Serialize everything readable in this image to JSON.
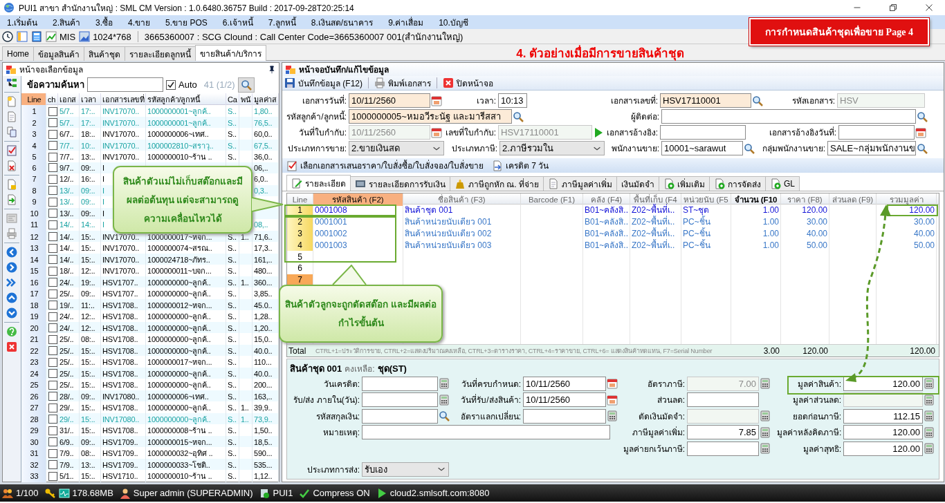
{
  "window": {
    "title": "PUI1 สาขา สำนักงานใหญ่ : SML CM Version : 1.0.6480.36757  Build : 2017-09-28T20:25:14"
  },
  "menu": [
    "1.เริ่มต้น",
    "2.สินค้า",
    "3.ซื้อ",
    "4.ขาย",
    "5.ขาย POS",
    "6.เจ้าหนี้",
    "7.ลูกหนี้",
    "8.เงินสด/ธนาคาร",
    "9.ค่าเสื่อม",
    "10.บัญชี"
  ],
  "toolbar": {
    "buttons": [
      {
        "label": "MIS",
        "kind": "chart"
      },
      {
        "label": "1024*768",
        "kind": "screen"
      }
    ],
    "info": "3665360007 : SCG Clound : Call Center Code=3665360007 001(สำนักงานใหญ่)"
  },
  "banner": "การกำหนดสินค้าชุดเพื่อขาย Page 4",
  "tabs": [
    {
      "label": "Home",
      "selected": false
    },
    {
      "label": "ข้อมูลสินค้า",
      "selected": false
    },
    {
      "label": "สินค้าชุด",
      "selected": false
    },
    {
      "label": "รายละเอียดลูกหนี้",
      "selected": false
    },
    {
      "label": "ขายสินค้า/บริการ",
      "selected": true
    }
  ],
  "heading": "4. ตัวอย่างเมื่อมีการขายสินค้าชุด",
  "list_panel": {
    "title": "หน้าจอเลือกข้อมูล",
    "search_label": "ข้อความค้นหา",
    "auto": {
      "label": "Auto",
      "checked": true
    },
    "count": "41 (1/2)",
    "columns": [
      {
        "label": "Line",
        "selected": true
      },
      {
        "label": "ch",
        "selected": false
      },
      {
        "label": "เอกส",
        "selected": false
      },
      {
        "label": "เวลา",
        "selected": false
      },
      {
        "label": "เอกสารเลขที่",
        "selected": false
      },
      {
        "label": "รหัสลูกค้า/ลูกหนี้",
        "selected": false
      },
      {
        "label": "Ca",
        "selected": false
      },
      {
        "label": "พนั",
        "selected": false
      },
      {
        "label": "มูลค่าส",
        "selected": false
      }
    ],
    "rows": [
      {
        "line": "1",
        "checked": false,
        "color": "#1aa3a3",
        "date": "5/7..",
        "time": "17:..",
        "doc": "INV17070..",
        "customer": "1000000001~ลูกค้..",
        "ca": "S..",
        "value": "1,80.."
      },
      {
        "line": "2",
        "checked": false,
        "color": "#1aa3a3",
        "date": "5/7..",
        "time": "17:..",
        "doc": "INV17070..",
        "customer": "1000000001~ลูกค้..",
        "ca": "S..",
        "value": "76,5.."
      },
      {
        "line": "3",
        "checked": false,
        "color": "#000000",
        "date": "6/7..",
        "time": "18:..",
        "doc": "INV17070..",
        "customer": "1000000006~เทศ..",
        "ca": "S..",
        "value": "60,0.."
      },
      {
        "line": "4",
        "checked": false,
        "color": "#1aa3a3",
        "date": "7/7..",
        "time": "10:..",
        "doc": "INV17070..",
        "customer": "1000002810~สราวุ..",
        "ca": "S..",
        "value": "67,5.."
      },
      {
        "line": "5",
        "checked": false,
        "color": "#000000",
        "date": "7/7..",
        "time": "13:..",
        "doc": "INV17070..",
        "customer": "1000000010~ร้าน ..",
        "ca": "S..",
        "value": "36,0.."
      },
      {
        "line": "6",
        "checked": false,
        "color": "#000000",
        "date": "9/7..",
        "time": "09:..",
        "doc": "I",
        "value": "06,.."
      },
      {
        "line": "7",
        "checked": false,
        "color": "#000000",
        "date": "12/..",
        "time": "16:..",
        "doc": "I",
        "value": "6,0.."
      },
      {
        "line": "8",
        "checked": false,
        "color": "#1aa3a3",
        "date": "13/..",
        "time": "09:..",
        "doc": "I",
        "value": "0,3.."
      },
      {
        "line": "9",
        "checked": false,
        "color": "#1aa3a3",
        "date": "13/..",
        "time": "09:..",
        "doc": "I"
      },
      {
        "line": "10",
        "checked": false,
        "color": "#000000",
        "date": "13/..",
        "time": "09:..",
        "doc": "I"
      },
      {
        "line": "11",
        "checked": false,
        "color": "#1aa3a3",
        "date": "14/..",
        "time": "14:..",
        "doc": "I",
        "value": "08,.."
      },
      {
        "line": "12",
        "checked": false,
        "color": "#000000",
        "date": "14/..",
        "time": "15:..",
        "doc": "INV17070..",
        "customer": "1000000017~หจก...",
        "ca": "S..",
        "pn": "1..",
        "value": "71,6.."
      },
      {
        "line": "13",
        "checked": false,
        "color": "#000000",
        "date": "14/..",
        "time": "15:..",
        "doc": "INV17070..",
        "customer": "1000000074~สรณ..",
        "ca": "S..",
        "value": "17,3.."
      },
      {
        "line": "14",
        "checked": false,
        "color": "#000000",
        "date": "14/..",
        "time": "15:..",
        "doc": "INV17070..",
        "customer": "1000024718~ภัทร..",
        "ca": "S..",
        "value": "161,.."
      },
      {
        "line": "15",
        "checked": false,
        "color": "#000000",
        "date": "18/..",
        "time": "12:..",
        "doc": "INV17070..",
        "customer": "1000000011~บจก...",
        "ca": "S..",
        "value": "480..."
      },
      {
        "line": "16",
        "checked": false,
        "color": "#000000",
        "date": "24/..",
        "time": "19:..",
        "doc": "HSV1707..",
        "customer": "1000000000~ลูกค้..",
        "ca": "S..",
        "pn": "1..",
        "value": "360..."
      },
      {
        "line": "17",
        "checked": false,
        "color": "#000000",
        "date": "25/..",
        "time": "09:..",
        "doc": "HSV1707..",
        "customer": "1000000000~ลูกค้..",
        "ca": "S..",
        "value": "3,85.."
      },
      {
        "line": "18",
        "checked": false,
        "color": "#000000",
        "date": "19/..",
        "time": "11:..",
        "doc": "HSV1708..",
        "customer": "1000000012~หจก...",
        "ca": "S..",
        "value": "45.0.."
      },
      {
        "line": "19",
        "checked": false,
        "color": "#000000",
        "date": "24/..",
        "time": "12:..",
        "doc": "HSV1708..",
        "customer": "1000000000~ลูกค้..",
        "ca": "S..",
        "value": "1,28.."
      },
      {
        "line": "20",
        "checked": false,
        "color": "#000000",
        "date": "24/..",
        "time": "12:..",
        "doc": "HSV1708..",
        "customer": "1000000000~ลูกค้..",
        "ca": "S..",
        "value": "1,20.."
      },
      {
        "line": "21",
        "checked": false,
        "color": "#000000",
        "date": "25/..",
        "time": "08:..",
        "doc": "HSV1708..",
        "customer": "1000000000~ลูกค้..",
        "ca": "S..",
        "value": "15,0.."
      },
      {
        "line": "22",
        "checked": false,
        "color": "#000000",
        "date": "25/..",
        "time": "15:..",
        "doc": "HSV1708..",
        "customer": "1000000000~ลูกค้..",
        "ca": "S..",
        "value": "40.0.."
      },
      {
        "line": "23",
        "checked": false,
        "color": "#000000",
        "date": "25/..",
        "time": "15:..",
        "doc": "HSV1708..",
        "customer": "1000000017~หจก...",
        "ca": "S..",
        "value": "110..."
      },
      {
        "line": "24",
        "checked": false,
        "color": "#000000",
        "date": "25/..",
        "time": "15:..",
        "doc": "HSV1708..",
        "customer": "1000000000~ลูกค้..",
        "ca": "S..",
        "value": "40.0.."
      },
      {
        "line": "25",
        "checked": false,
        "color": "#000000",
        "date": "25/..",
        "time": "15:..",
        "doc": "HSV1708..",
        "customer": "1000000000~ลูกค้..",
        "ca": "S..",
        "value": "200..."
      },
      {
        "line": "26",
        "checked": false,
        "color": "#000000",
        "date": "28/..",
        "time": "09:..",
        "doc": "INV17080..",
        "customer": "1000000006~เทศ..",
        "ca": "S..",
        "value": "163,.."
      },
      {
        "line": "27",
        "checked": false,
        "color": "#000000",
        "date": "29/..",
        "time": "15:..",
        "doc": "HSV1708..",
        "customer": "1000000000~ลูกค้..",
        "ca": "S..",
        "pn": "1..",
        "value": "39,9.."
      },
      {
        "line": "28",
        "checked": false,
        "color": "#1aa3a3",
        "date": "29/..",
        "time": "15:..",
        "doc": "INV17080..",
        "customer": "1000000000~ลูกค้..",
        "ca": "S..",
        "pn": "1..",
        "value": "73,9.."
      },
      {
        "line": "29",
        "checked": false,
        "color": "#000000",
        "date": "31/..",
        "time": "15:..",
        "doc": "HSV1708..",
        "customer": "1000000008~ร้าน ..",
        "ca": "S..",
        "value": "1,50.."
      },
      {
        "line": "30",
        "checked": false,
        "color": "#000000",
        "date": "6/9..",
        "time": "09:..",
        "doc": "HSV1709..",
        "customer": "1000000015~หจก...",
        "ca": "S..",
        "value": "18,5.."
      },
      {
        "line": "31",
        "checked": false,
        "color": "#000000",
        "date": "7/9..",
        "time": "08:..",
        "doc": "HSV1709..",
        "customer": "1000000032~อุทิศ ..",
        "ca": "S..",
        "value": "590..."
      },
      {
        "line": "32",
        "checked": false,
        "color": "#000000",
        "date": "7/9..",
        "time": "13:..",
        "doc": "HSV1709..",
        "customer": "1000000033~โชติ..",
        "ca": "S..",
        "value": "535..."
      },
      {
        "line": "33",
        "checked": false,
        "color": "#000000",
        "date": "5/1..",
        "time": "15:..",
        "doc": "HSV1710..",
        "customer": "1000000010~ร้าน ..",
        "ca": "S..",
        "value": "1,12.."
      }
    ]
  },
  "edit": {
    "title": "หน้าจอบันทึก/แก้ไขข้อมูล",
    "actions": [
      {
        "label": "บันทึกข้อมูล (F12)",
        "kind": "save"
      },
      {
        "label": "พิมพ์เอกสาร",
        "kind": "print"
      },
      {
        "label": "ปิดหน้าจอ",
        "kind": "close"
      }
    ],
    "form": [
      [
        {
          "label": "เอกสารวันที่:",
          "value": "10/11/2560",
          "kind": "date",
          "required": true,
          "disabled": false
        },
        {
          "label": "เวลา:",
          "value": "10:13",
          "kind": "text",
          "required": false,
          "disabled": false
        },
        {
          "label": "เอกสารเลขที่:",
          "value": "HSV17110001",
          "kind": "lookup",
          "required": true,
          "disabled": false
        },
        {
          "label": "รหัสเอกสาร:",
          "value": "HSV",
          "kind": "text",
          "required": false,
          "disabled": true
        }
      ],
      [
        {
          "label": "รหัสลูกค้า/ลูกหนี้:",
          "value": "1000000005~หมอวีระนัฐ และมารีสสา",
          "kind": "lookup",
          "required": true,
          "disabled": false
        },
        {
          "label": "ผู้ติดต่อ:",
          "kind": "lookup",
          "required": false,
          "disabled": false
        }
      ],
      [
        {
          "label": "วันที่ใบกำกับ:",
          "value": "10/11/2560",
          "kind": "date",
          "required": false,
          "disabled": true
        },
        {
          "label": "เลขที่ใบกำกับ:",
          "value": "HSV17110001",
          "kind": "go",
          "required": false,
          "disabled": true
        },
        {
          "label": "เอกสารอ้างอิง:",
          "kind": "text",
          "required": false,
          "disabled": false
        },
        {
          "label": "เอกสารอ้างอิงวันที่:",
          "kind": "date",
          "required": false,
          "disabled": false
        }
      ],
      [
        {
          "label": "ประเภทการขาย:",
          "value": "2.ขายเงินสด",
          "kind": "select",
          "required": false,
          "disabled": false
        },
        {
          "label": "ประเภทภาษี:",
          "value": "2.ภาษีรวมใน",
          "kind": "select",
          "required": false,
          "disabled": false
        },
        {
          "label": "พนักงานขาย:",
          "value": "10001~sarawut",
          "kind": "lookup",
          "required": false,
          "disabled": false
        },
        {
          "label": "กลุ่มพนักงานขาย:",
          "value": "SALE~กลุ่มพนักงานข",
          "kind": "lookup",
          "required": false,
          "disabled": false
        }
      ]
    ],
    "links": [
      {
        "label": "เลือกเอกสารเสนอราคา/ใบสั่งซื้อ/ใบสั่งจอง/ใบสั่งขาย",
        "kind": "checklist"
      },
      {
        "label": "เครดิต 7 วัน",
        "kind": "credit"
      }
    ],
    "tabs": [
      {
        "label": "รายละเอียด",
        "kind": "edit",
        "selected": true
      },
      {
        "label": "รายละเอียดการรับเงิน",
        "kind": "money",
        "selected": false
      },
      {
        "label": "ภาษีถูกหัก ณ. ที่จ่าย",
        "kind": "bag",
        "selected": false
      },
      {
        "label": "ภาษีมูลค่าเพิ่ม",
        "kind": "doc",
        "selected": false
      },
      {
        "label": "เงินมัดจำ",
        "kind": "none",
        "selected": false
      },
      {
        "label": "เพิ่มเติม",
        "kind": "add",
        "selected": false
      },
      {
        "label": "การจัดส่ง",
        "kind": "add",
        "selected": false
      },
      {
        "label": "GL",
        "kind": "add",
        "selected": false
      }
    ],
    "grid": {
      "columns": [
        {
          "label": "Line",
          "selected": false
        },
        {
          "label": "รหัสสินค้า (F2)",
          "selected": true
        },
        {
          "label": "ชื่อสินค้า (F3)",
          "selected": false
        },
        {
          "label": "Barcode (F1)",
          "selected": false
        },
        {
          "label": "คลัง (F4)",
          "selected": false
        },
        {
          "label": "พื้นที่เก็บ (F4",
          "selected": false
        },
        {
          "label": "หน่วยนับ (F5",
          "selected": false
        },
        {
          "label": "จำนวน (F10",
          "selected": false
        },
        {
          "label": "ราคา (F8)",
          "selected": false
        },
        {
          "label": "ส่วนลด (F9)",
          "selected": false
        },
        {
          "label": "รวมมูลค่า",
          "selected": false
        }
      ],
      "items": [
        {
          "line": "1",
          "code": "0001008",
          "name": "สินค้าชุด 001",
          "warehouse": "B01~คลังสิ..",
          "location": "Z02~พื้นที่เ..",
          "unit": "ST~ชุด",
          "qty": "1.00",
          "price": "120.00",
          "amount": "120.00",
          "kind": "set"
        },
        {
          "line": "2",
          "code": "0001001",
          "name": "สินค้าหน่วยนับเดียว 001",
          "warehouse": "B01~คลังสิ..",
          "location": "Z02~พื้นที่เ..",
          "unit": "PC~ชิ้น",
          "qty": "1.00",
          "price": "30.00",
          "amount": "30.00",
          "kind": "component"
        },
        {
          "line": "3",
          "code": "0001002",
          "name": "สินค้าหน่วยนับเดียว 002",
          "warehouse": "B01~คลังสิ..",
          "location": "Z02~พื้นที่เ..",
          "unit": "PC~ชิ้น",
          "qty": "1.00",
          "price": "40.00",
          "amount": "40.00",
          "kind": "component"
        },
        {
          "line": "4",
          "code": "0001003",
          "name": "สินค้าหน่วยนับเดียว 003",
          "warehouse": "B01~คลังสิ..",
          "location": "Z02~พื้นที่เ..",
          "unit": "PC~ชิ้น",
          "qty": "1.00",
          "price": "50.00",
          "amount": "50.00",
          "kind": "component"
        }
      ],
      "empty_lines": [
        {
          "line": "5",
          "selected": false
        },
        {
          "line": "6",
          "selected": false
        },
        {
          "line": "7",
          "selected": true
        }
      ],
      "hint": "CTRL+1=ประวัติการขาย, CTRL+2=แสดงปริมาณคงเหลือ, CTRL+3=ตารางราคา, CTRL+4=ราคาขาย, CTRL+6= แสดงสินค้าทดแทน, F7=Serial Number",
      "total": {
        "label": "Total",
        "qty": "3.00",
        "price": "120.00",
        "amount": "120.00"
      }
    },
    "summary": {
      "title": "สินค้าชุด 001",
      "balance_label": "คงเหลือ:",
      "unit": "ชุด(ST)",
      "columns": [
        [
          {
            "label": "วันเครดิต:",
            "kind": "calc",
            "disabled": false
          },
          {
            "label": "รับ/ส่ง ภายใน(วัน):",
            "kind": "calc",
            "disabled": false
          },
          {
            "label": "รหัสสกุลเงิน:",
            "kind": "lookup",
            "disabled": false
          },
          {
            "label": "หมายเหตุ:",
            "kind": "note",
            "disabled": false
          }
        ],
        [
          {
            "label": "วันที่ครบกำหนด:",
            "value": "10/11/2560",
            "kind": "date",
            "disabled": false
          },
          {
            "label": "วันที่รับ/ส่งสินค้า:",
            "value": "10/11/2560",
            "kind": "date",
            "disabled": false
          },
          {
            "label": "อัตราแลกเปลี่ยน:",
            "kind": "calc",
            "disabled": false
          }
        ],
        [
          {
            "label": "อัตราภาษี:",
            "value": "7.00",
            "kind": "calc",
            "disabled": true
          },
          {
            "label": "ส่วนลด:",
            "kind": "text",
            "disabled": false
          },
          {
            "label": "ตัดเงินมัดจำ:",
            "kind": "calc",
            "disabled": true
          },
          {
            "label": "ภาษีมูลค่าเพิ่ม:",
            "value": "7.85",
            "kind": "calc",
            "disabled": false
          },
          {
            "label": "มูลค่ายกเว้นภาษี:",
            "kind": "calc",
            "disabled": false
          }
        ],
        [
          {
            "label": "มูลค่าสินค้า:",
            "value": "120.00",
            "kind": "calc",
            "disabled": false
          },
          {
            "label": "มูลค่าส่วนลด:",
            "kind": "calc",
            "disabled": true
          },
          {
            "label": "ยอดก่อนภาษี:",
            "value": "112.15",
            "kind": "calc",
            "disabled": false
          },
          {
            "label": "มูลค่าหลังคิดภาษี:",
            "value": "120.00",
            "kind": "calc",
            "disabled": false
          },
          {
            "label": "มูลค่าสุทธิ:",
            "value": "120.00",
            "kind": "calc",
            "disabled": false
          }
        ]
      ],
      "shipping": {
        "label": "ประเภทการส่ง:",
        "value": "รับเอง",
        "kind": "select",
        "disabled": false
      }
    }
  },
  "callouts": [
    {
      "text": "สินค้าตัวแม่ไม่เก็บสต๊อกและมีผลต่อต้นทุน แต่จะสามารถดูความเคลื่อนไหวได้"
    },
    {
      "text": "สินค้าตัวลูกจะถูกตัดสต๊อก และมีผลต่อกำไรขั้นต้น"
    }
  ],
  "status_bar": [
    {
      "label": "1/100",
      "kind": "users"
    },
    {
      "label": "178.68MB",
      "kind": "memory"
    },
    {
      "label": "Super admin (SUPERADMIN)",
      "kind": "user"
    },
    {
      "label": "PUI1",
      "kind": "server"
    },
    {
      "label": "Compress ON",
      "kind": "check"
    },
    {
      "label": "cloud2.smlsoft.com:8080",
      "kind": "play"
    }
  ]
}
